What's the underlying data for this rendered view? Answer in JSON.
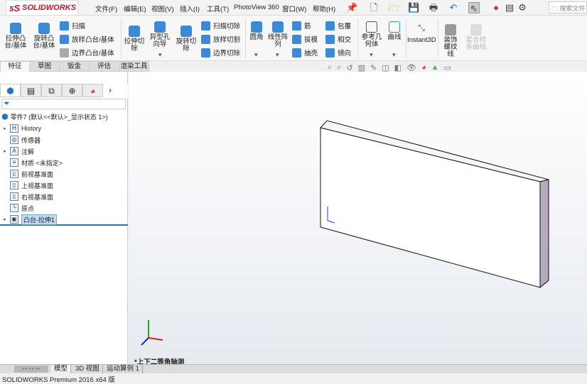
{
  "app": {
    "logo": "SOLIDWORKS"
  },
  "menu": [
    "文件(F)",
    "编辑(E)",
    "视图(V)",
    "插入(I)",
    "工具(T)",
    "PhotoView 360",
    "窗口(W)",
    "帮助(H)"
  ],
  "search_placeholder": "搜索文件",
  "commands": {
    "extrude_boss": "拉伸凸台/基体",
    "revolve_boss": "旋转凸台/基体",
    "sweep": "扫描",
    "loft_boss": "放样凸台/基体",
    "boundary_boss": "边界凸台/基体",
    "extrude_cut": "拉伸切除",
    "hole_wizard": "异型孔向导",
    "revolve_cut": "旋转切除",
    "sweep_cut": "扫描切除",
    "loft_cut": "放样切割",
    "boundary_cut": "边界切除",
    "fillet": "圆角",
    "linear_pattern": "线性阵列",
    "rib": "筋",
    "draft": "拔模",
    "shell": "抽壳",
    "wrap": "包覆",
    "intersect": "相交",
    "mirror": "镜向",
    "ref_geometry": "参考几何体",
    "curves": "曲线",
    "instant3d": "Instant3D",
    "cosmetic_thread": "装饰螺纹线",
    "composite_curve": "套合样条曲线"
  },
  "tabs": [
    "特征",
    "草图",
    "钣金",
    "评估",
    "渲染工具"
  ],
  "tree": {
    "root": "零件7  (默认<<默认>_显示状态 1>)",
    "items": [
      {
        "label": "History",
        "expand": true
      },
      {
        "label": "传感器",
        "expand": false
      },
      {
        "label": "注解",
        "expand": true
      },
      {
        "label": "材质 <未指定>",
        "expand": false
      },
      {
        "label": "前视基准面",
        "expand": false
      },
      {
        "label": "上视基准面",
        "expand": false
      },
      {
        "label": "右视基准面",
        "expand": false
      },
      {
        "label": "原点",
        "expand": false
      },
      {
        "label": "凸台-拉伸1",
        "expand": true,
        "selected": true
      }
    ]
  },
  "view_label": "*上下二等角轴测",
  "bottom_tabs": [
    "模型",
    "3D 视图",
    "运动算例 1"
  ],
  "status": "SOLIDWORKS Premium 2016 x64 版"
}
